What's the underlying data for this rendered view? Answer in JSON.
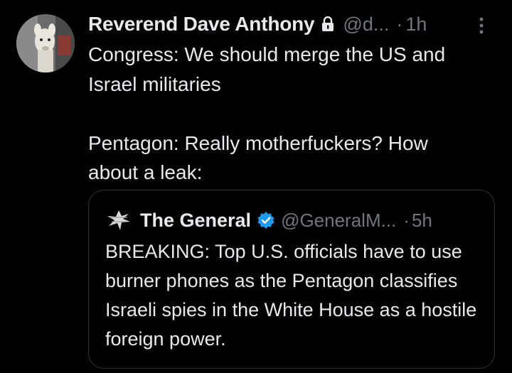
{
  "tweet": {
    "avatar_icon": "profile-photo-llama",
    "display_name": "Reverend Dave Anthony",
    "lock_icon": "lock-icon",
    "handle": "@d...",
    "separator": "·",
    "time": "1h",
    "more_icon": "more-vertical-icon",
    "text": "Congress: We should merge the US and\nIsrael militaries\n\nPentagon: Really motherfuckers? How\nabout a leak:"
  },
  "quote": {
    "avatar_icon": "bird-logo-icon",
    "display_name": "The General",
    "verified_icon": "verified-badge-icon",
    "verified_color": "#1d9bf0",
    "handle": "@GeneralM...",
    "separator": "·",
    "time": "5h",
    "text": "BREAKING: Top U.S. officials have to use burner phones as the Pentagon classifies Israeli spies in the White House as a hostile foreign power."
  },
  "colors": {
    "background": "#000000",
    "primary_text": "#e7e9ea",
    "secondary_text": "#71767b",
    "border": "#2f3336"
  }
}
